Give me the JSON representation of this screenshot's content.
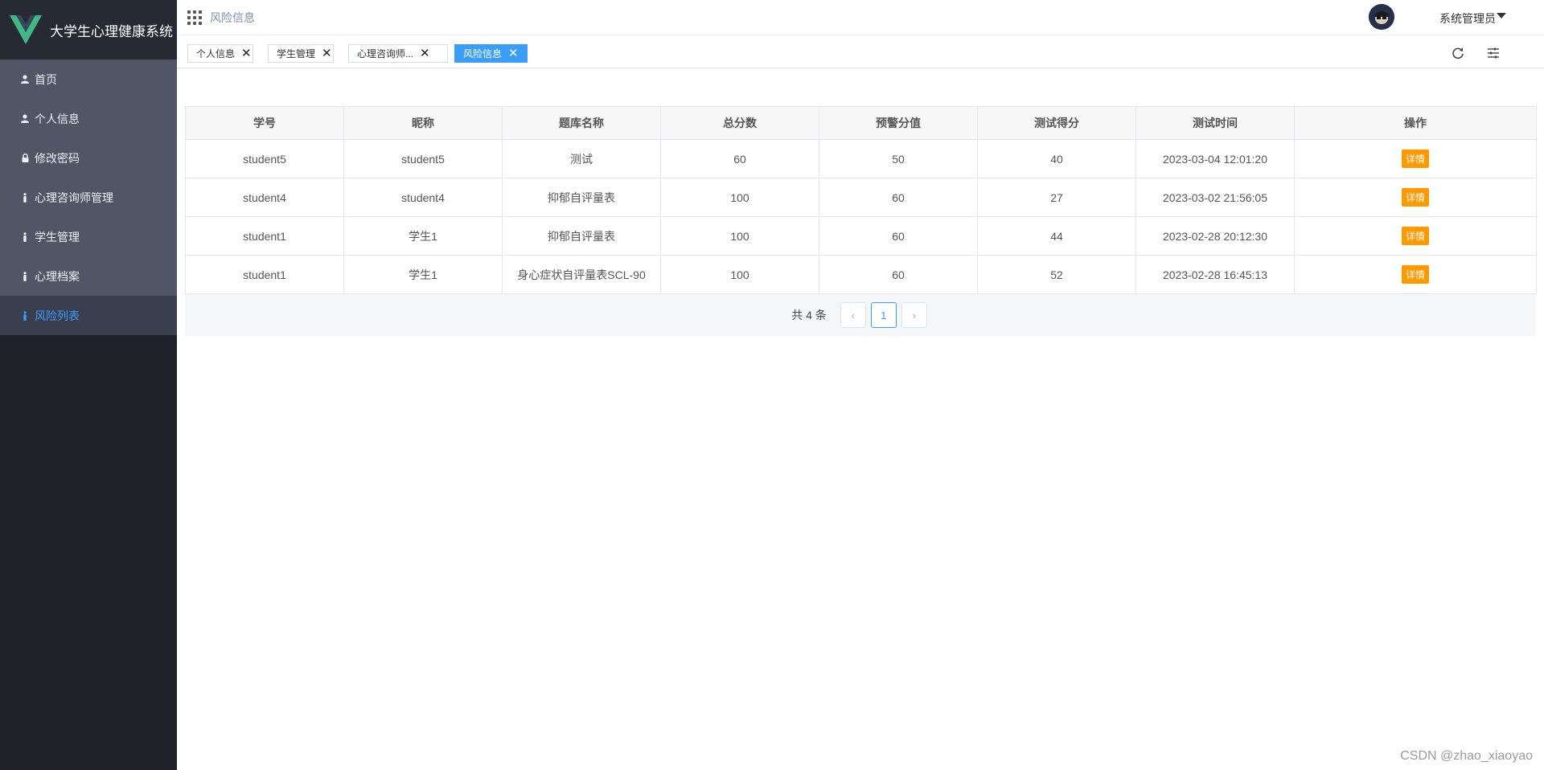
{
  "app": {
    "title": "大学生心理健康系统"
  },
  "sidebar": {
    "items": [
      {
        "label": "首页",
        "icon": "user-icon",
        "active": false
      },
      {
        "label": "个人信息",
        "icon": "user-icon",
        "active": false
      },
      {
        "label": "修改密码",
        "icon": "lock-icon",
        "active": false
      },
      {
        "label": "心理咨询师管理",
        "icon": "person-icon",
        "active": false
      },
      {
        "label": "学生管理",
        "icon": "person-icon",
        "active": false
      },
      {
        "label": "心理档案",
        "icon": "person-icon",
        "active": false
      },
      {
        "label": "风险列表",
        "icon": "person-icon",
        "active": true
      }
    ]
  },
  "header": {
    "breadcrumb": "风险信息",
    "user_name": "系统管理员"
  },
  "tags": [
    {
      "label": "个人信息",
      "active": false
    },
    {
      "label": "学生管理",
      "active": false
    },
    {
      "label": "心理咨询师...",
      "active": false
    },
    {
      "label": "风险信息",
      "active": true
    }
  ],
  "table": {
    "columns": [
      "学号",
      "昵称",
      "题库名称",
      "总分数",
      "预警分值",
      "测试得分",
      "测试时间",
      "操作"
    ],
    "rows": [
      [
        "student5",
        "student5",
        "测试",
        "60",
        "50",
        "40",
        "2023-03-04 12:01:20"
      ],
      [
        "student4",
        "student4",
        "抑郁自评量表",
        "100",
        "60",
        "27",
        "2023-03-02 21:56:05"
      ],
      [
        "student1",
        "学生1",
        "抑郁自评量表",
        "100",
        "60",
        "44",
        "2023-02-28 20:12:30"
      ],
      [
        "student1",
        "学生1",
        "身心症状自评量表SCL-90",
        "100",
        "60",
        "52",
        "2023-02-28 16:45:13"
      ]
    ],
    "action_label": "详情"
  },
  "pagination": {
    "total_text": "共 4 条",
    "current_page": "1",
    "prev": "‹",
    "next": "›"
  },
  "watermark": "CSDN @zhao_xiaoyao",
  "colors": {
    "sidebar_bg": "#1f2129",
    "menu_bg": "#515666",
    "accent": "#3b9df8",
    "action": "#ff9900"
  }
}
